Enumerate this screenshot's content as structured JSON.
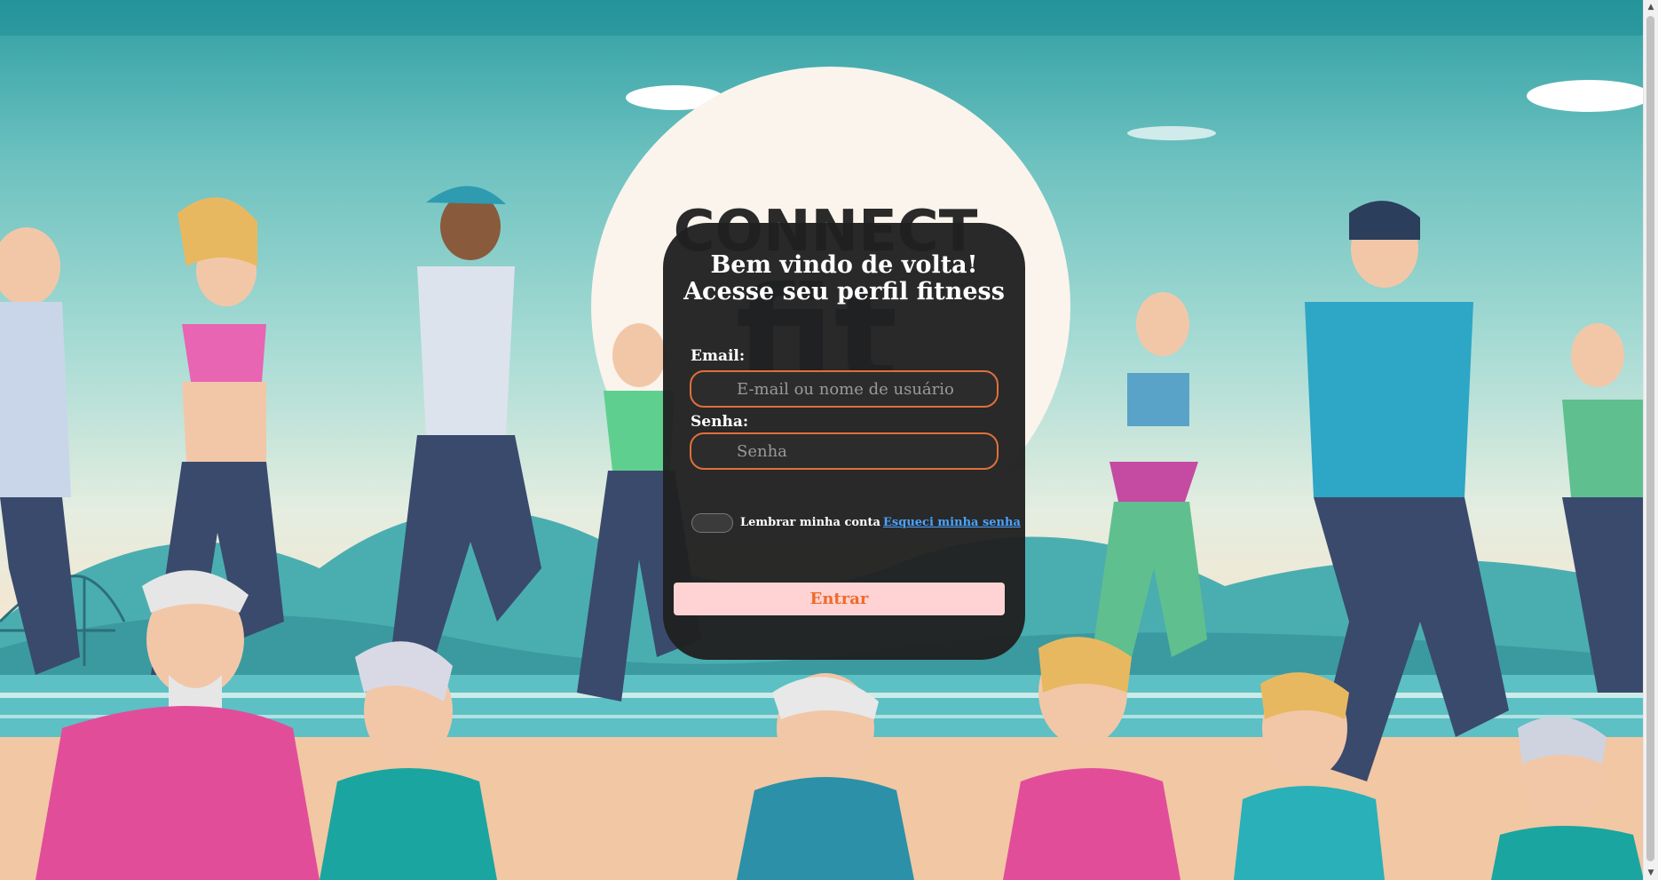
{
  "login": {
    "heading_line1": "Bem vindo de volta!",
    "heading_line2": "Acesse seu perfil fitness",
    "email_label": "Email:",
    "email_placeholder": "E-mail ou nome de usuário",
    "password_label": "Senha:",
    "password_placeholder": "Senha",
    "remember_label": "Lembrar minha conta",
    "forgot_link": "Esqueci minha senha",
    "submit_label": "Entrar"
  },
  "background": {
    "logo_text_top": "CONNECT",
    "logo_text_bottom": "fit"
  },
  "colors": {
    "card_bg": "#202020",
    "field_border": "#e0703a",
    "button_bg": "#ffd3d3",
    "button_text": "#f06a2a",
    "link": "#4aa3ff"
  }
}
